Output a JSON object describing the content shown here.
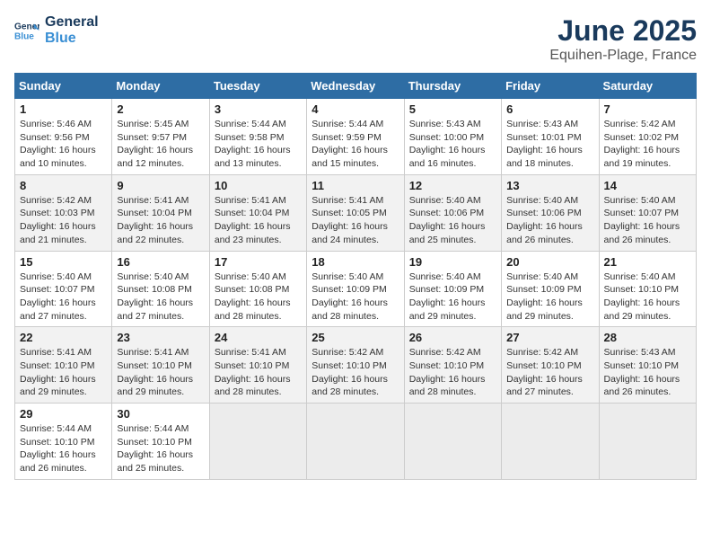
{
  "logo": {
    "line1": "General",
    "line2": "Blue"
  },
  "title": "June 2025",
  "subtitle": "Equihen-Plage, France",
  "days_of_week": [
    "Sunday",
    "Monday",
    "Tuesday",
    "Wednesday",
    "Thursday",
    "Friday",
    "Saturday"
  ],
  "weeks": [
    [
      {
        "day": "1",
        "sunrise": "5:46 AM",
        "sunset": "9:56 PM",
        "daylight": "16 hours and 10 minutes."
      },
      {
        "day": "2",
        "sunrise": "5:45 AM",
        "sunset": "9:57 PM",
        "daylight": "16 hours and 12 minutes."
      },
      {
        "day": "3",
        "sunrise": "5:44 AM",
        "sunset": "9:58 PM",
        "daylight": "16 hours and 13 minutes."
      },
      {
        "day": "4",
        "sunrise": "5:44 AM",
        "sunset": "9:59 PM",
        "daylight": "16 hours and 15 minutes."
      },
      {
        "day": "5",
        "sunrise": "5:43 AM",
        "sunset": "10:00 PM",
        "daylight": "16 hours and 16 minutes."
      },
      {
        "day": "6",
        "sunrise": "5:43 AM",
        "sunset": "10:01 PM",
        "daylight": "16 hours and 18 minutes."
      },
      {
        "day": "7",
        "sunrise": "5:42 AM",
        "sunset": "10:02 PM",
        "daylight": "16 hours and 19 minutes."
      }
    ],
    [
      {
        "day": "8",
        "sunrise": "5:42 AM",
        "sunset": "10:03 PM",
        "daylight": "16 hours and 21 minutes."
      },
      {
        "day": "9",
        "sunrise": "5:41 AM",
        "sunset": "10:04 PM",
        "daylight": "16 hours and 22 minutes."
      },
      {
        "day": "10",
        "sunrise": "5:41 AM",
        "sunset": "10:04 PM",
        "daylight": "16 hours and 23 minutes."
      },
      {
        "day": "11",
        "sunrise": "5:41 AM",
        "sunset": "10:05 PM",
        "daylight": "16 hours and 24 minutes."
      },
      {
        "day": "12",
        "sunrise": "5:40 AM",
        "sunset": "10:06 PM",
        "daylight": "16 hours and 25 minutes."
      },
      {
        "day": "13",
        "sunrise": "5:40 AM",
        "sunset": "10:06 PM",
        "daylight": "16 hours and 26 minutes."
      },
      {
        "day": "14",
        "sunrise": "5:40 AM",
        "sunset": "10:07 PM",
        "daylight": "16 hours and 26 minutes."
      }
    ],
    [
      {
        "day": "15",
        "sunrise": "5:40 AM",
        "sunset": "10:07 PM",
        "daylight": "16 hours and 27 minutes."
      },
      {
        "day": "16",
        "sunrise": "5:40 AM",
        "sunset": "10:08 PM",
        "daylight": "16 hours and 27 minutes."
      },
      {
        "day": "17",
        "sunrise": "5:40 AM",
        "sunset": "10:08 PM",
        "daylight": "16 hours and 28 minutes."
      },
      {
        "day": "18",
        "sunrise": "5:40 AM",
        "sunset": "10:09 PM",
        "daylight": "16 hours and 28 minutes."
      },
      {
        "day": "19",
        "sunrise": "5:40 AM",
        "sunset": "10:09 PM",
        "daylight": "16 hours and 29 minutes."
      },
      {
        "day": "20",
        "sunrise": "5:40 AM",
        "sunset": "10:09 PM",
        "daylight": "16 hours and 29 minutes."
      },
      {
        "day": "21",
        "sunrise": "5:40 AM",
        "sunset": "10:10 PM",
        "daylight": "16 hours and 29 minutes."
      }
    ],
    [
      {
        "day": "22",
        "sunrise": "5:41 AM",
        "sunset": "10:10 PM",
        "daylight": "16 hours and 29 minutes."
      },
      {
        "day": "23",
        "sunrise": "5:41 AM",
        "sunset": "10:10 PM",
        "daylight": "16 hours and 29 minutes."
      },
      {
        "day": "24",
        "sunrise": "5:41 AM",
        "sunset": "10:10 PM",
        "daylight": "16 hours and 28 minutes."
      },
      {
        "day": "25",
        "sunrise": "5:42 AM",
        "sunset": "10:10 PM",
        "daylight": "16 hours and 28 minutes."
      },
      {
        "day": "26",
        "sunrise": "5:42 AM",
        "sunset": "10:10 PM",
        "daylight": "16 hours and 28 minutes."
      },
      {
        "day": "27",
        "sunrise": "5:42 AM",
        "sunset": "10:10 PM",
        "daylight": "16 hours and 27 minutes."
      },
      {
        "day": "28",
        "sunrise": "5:43 AM",
        "sunset": "10:10 PM",
        "daylight": "16 hours and 26 minutes."
      }
    ],
    [
      {
        "day": "29",
        "sunrise": "5:44 AM",
        "sunset": "10:10 PM",
        "daylight": "16 hours and 26 minutes."
      },
      {
        "day": "30",
        "sunrise": "5:44 AM",
        "sunset": "10:10 PM",
        "daylight": "16 hours and 25 minutes."
      },
      null,
      null,
      null,
      null,
      null
    ]
  ],
  "label_sunrise": "Sunrise:",
  "label_sunset": "Sunset:",
  "label_daylight": "Daylight:"
}
